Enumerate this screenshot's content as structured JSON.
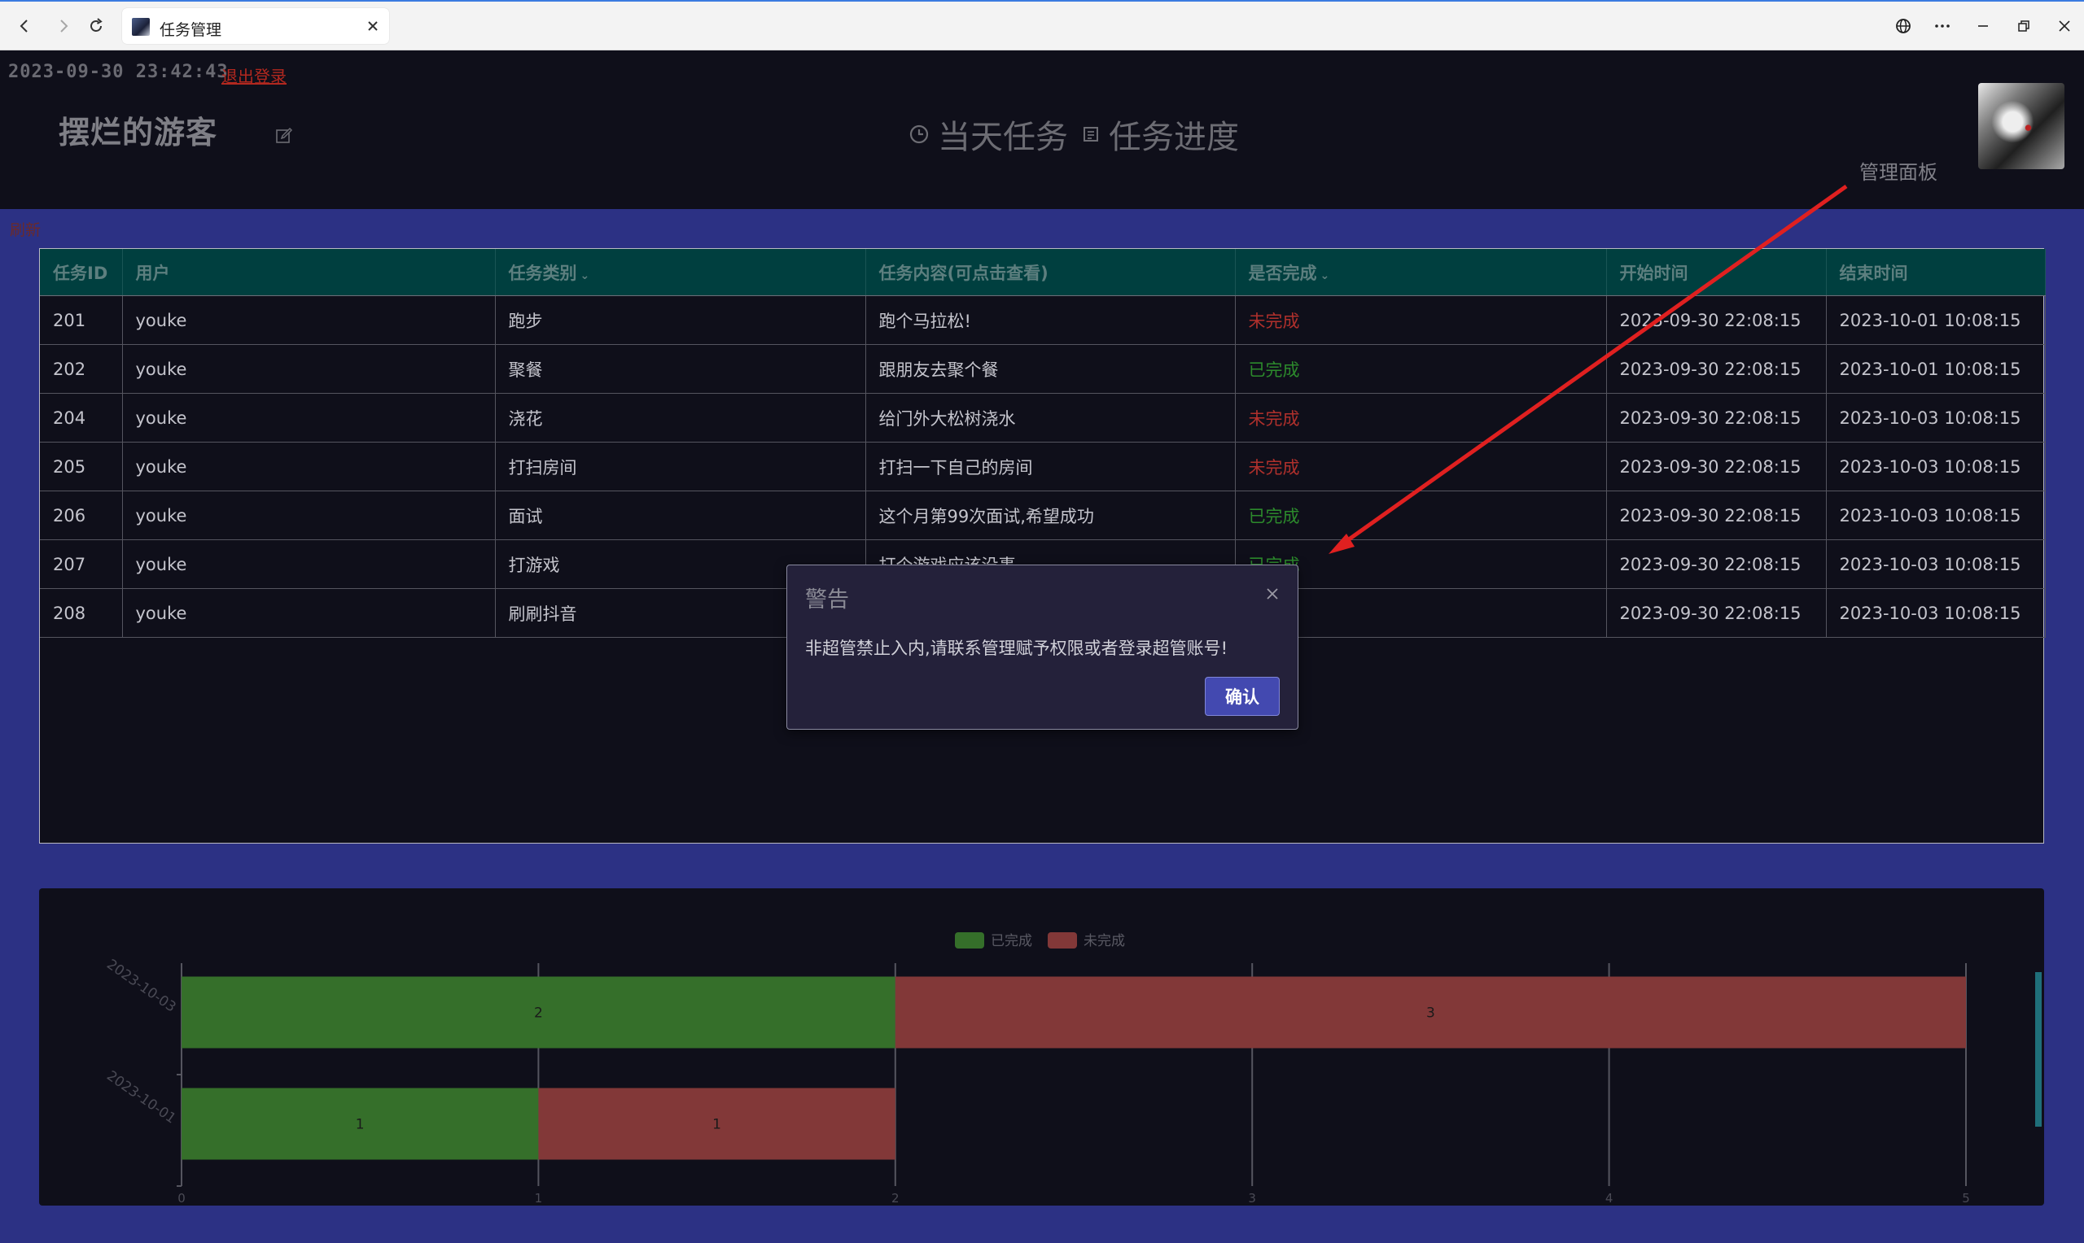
{
  "browser": {
    "tab_title": "任务管理",
    "back_icon": "chevron-left-icon",
    "forward_icon": "chevron-right-icon",
    "reload_icon": "reload-icon",
    "close_tab_icon": "close-icon"
  },
  "header": {
    "datetime": "2023-09-30 23:42:43",
    "logout_label": "退出登录",
    "username": "摆烂的游客",
    "nav": [
      {
        "label": "当天任务",
        "icon": "clock-icon"
      },
      {
        "label": "任务进度",
        "icon": "document-icon"
      }
    ],
    "admin_panel_label": "管理面板"
  },
  "refresh_label": "刷新",
  "table": {
    "columns": [
      "任务ID",
      "用户",
      "任务类别",
      "任务内容(可点击查看)",
      "是否完成",
      "开始时间",
      "结束时间"
    ],
    "rows": [
      {
        "id": "201",
        "user": "youke",
        "category": "跑步",
        "content": "跑个马拉松!",
        "status": "未完成",
        "start": "2023-09-30 22:08:15",
        "end": "2023-10-01 10:08:15"
      },
      {
        "id": "202",
        "user": "youke",
        "category": "聚餐",
        "content": "跟朋友去聚个餐",
        "status": "已完成",
        "start": "2023-09-30 22:08:15",
        "end": "2023-10-01 10:08:15"
      },
      {
        "id": "204",
        "user": "youke",
        "category": "浇花",
        "content": "给门外大松树浇水",
        "status": "未完成",
        "start": "2023-09-30 22:08:15",
        "end": "2023-10-03 10:08:15"
      },
      {
        "id": "205",
        "user": "youke",
        "category": "打扫房间",
        "content": "打扫一下自己的房间",
        "status": "未完成",
        "start": "2023-09-30 22:08:15",
        "end": "2023-10-03 10:08:15"
      },
      {
        "id": "206",
        "user": "youke",
        "category": "面试",
        "content": "这个月第99次面试,希望成功",
        "status": "已完成",
        "start": "2023-09-30 22:08:15",
        "end": "2023-10-03 10:08:15"
      },
      {
        "id": "207",
        "user": "youke",
        "category": "打游戏",
        "content": "打个游戏应该没事",
        "status": "已完成",
        "start": "2023-09-30 22:08:15",
        "end": "2023-10-03 10:08:15"
      },
      {
        "id": "208",
        "user": "youke",
        "category": "刷刷抖音",
        "content": "",
        "status": "",
        "start": "2023-09-30 22:08:15",
        "end": "2023-10-03 10:08:15"
      }
    ]
  },
  "chart_data": {
    "type": "bar",
    "orientation": "horizontal",
    "stacked": true,
    "categories": [
      "2023-10-03",
      "2023-10-01"
    ],
    "series": [
      {
        "name": "已完成",
        "values": [
          2,
          1
        ],
        "color": "#356f2a"
      },
      {
        "name": "未完成",
        "values": [
          3,
          1
        ],
        "color": "#823838"
      }
    ],
    "xlim": [
      0,
      5
    ],
    "xticks": [
      "0",
      "1",
      "2",
      "3",
      "4",
      "5"
    ],
    "grid": true,
    "legend_position": "top-center"
  },
  "modal": {
    "title": "警告",
    "message": "非超管禁止入内,请联系管理赋予权限或者登录超管账号!",
    "confirm_label": "确认"
  },
  "colors": {
    "page_bg": "#2c3184",
    "panel_bg": "#0f0f1a",
    "table_header_bg": "#003f3f",
    "done": "#2c8a2c",
    "undone": "#b0302c",
    "annotation_arrow": "#e02020",
    "confirm_button": "#4349b0"
  }
}
